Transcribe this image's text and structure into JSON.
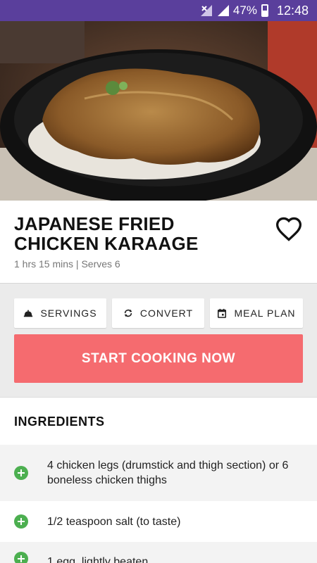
{
  "status_bar": {
    "battery_percent": "47%",
    "time": "12:48",
    "color": "#5a3f9c"
  },
  "hero_image": {
    "description_icon": "recipe-photo"
  },
  "recipe": {
    "title": "JAPANESE FRIED CHICKEN KARAAGE",
    "meta": "1 hrs 15 mins | Serves 6",
    "favorite_icon": "heart-outline-icon"
  },
  "actions": {
    "servings_label": "SERVINGS",
    "convert_label": "CONVERT",
    "meal_plan_label": "MEAL PLAN",
    "start_cooking_label": "START COOKING NOW",
    "accent_color": "#f56b6f"
  },
  "ingredients": {
    "header": "INGREDIENTS",
    "items": [
      {
        "text": "4 chicken legs (drumstick and thigh section) or 6 boneless chicken thighs"
      },
      {
        "text": "1/2 teaspoon salt (to taste)"
      },
      {
        "text": "1 egg, lightly beaten"
      }
    ],
    "add_icon_color": "#4caf50"
  }
}
